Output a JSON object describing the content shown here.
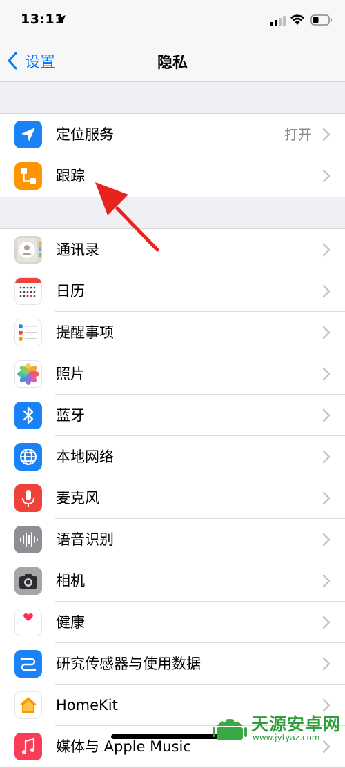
{
  "status_bar": {
    "time": "13:11"
  },
  "nav": {
    "back_label": "设置",
    "title": "隐私"
  },
  "group1": [
    {
      "label": "定位服务",
      "value": "打开",
      "icon": "location-arrow-icon",
      "color": "#1a82f7"
    },
    {
      "label": "跟踪",
      "value": "",
      "icon": "tracking-icon",
      "color": "#ff9500"
    }
  ],
  "group2": [
    {
      "label": "通讯录",
      "icon": "contacts-icon"
    },
    {
      "label": "日历",
      "icon": "calendar-icon"
    },
    {
      "label": "提醒事项",
      "icon": "reminders-icon"
    },
    {
      "label": "照片",
      "icon": "photos-icon"
    },
    {
      "label": "蓝牙",
      "icon": "bluetooth-icon",
      "color": "#1a82f7"
    },
    {
      "label": "本地网络",
      "icon": "globe-icon",
      "color": "#1a82f7"
    },
    {
      "label": "麦克风",
      "icon": "microphone-icon",
      "color": "#f0413b"
    },
    {
      "label": "语音识别",
      "icon": "speech-recognition-icon",
      "color": "#8e8e93"
    },
    {
      "label": "相机",
      "icon": "camera-icon",
      "color": "#8e8e93"
    },
    {
      "label": "健康",
      "icon": "health-heart-icon",
      "color": "#ff2d55"
    },
    {
      "label": "研究传感器与使用数据",
      "icon": "research-sensor-icon",
      "color": "#1a82f7"
    },
    {
      "label": "HomeKit",
      "icon": "homekit-house-icon",
      "color": "#ff9500"
    },
    {
      "label": "媒体与 Apple Music",
      "icon": "music-icon",
      "color": "#fa3d57"
    }
  ],
  "watermark": {
    "text": "天源安卓网",
    "url": "www.jytyaz.com"
  }
}
